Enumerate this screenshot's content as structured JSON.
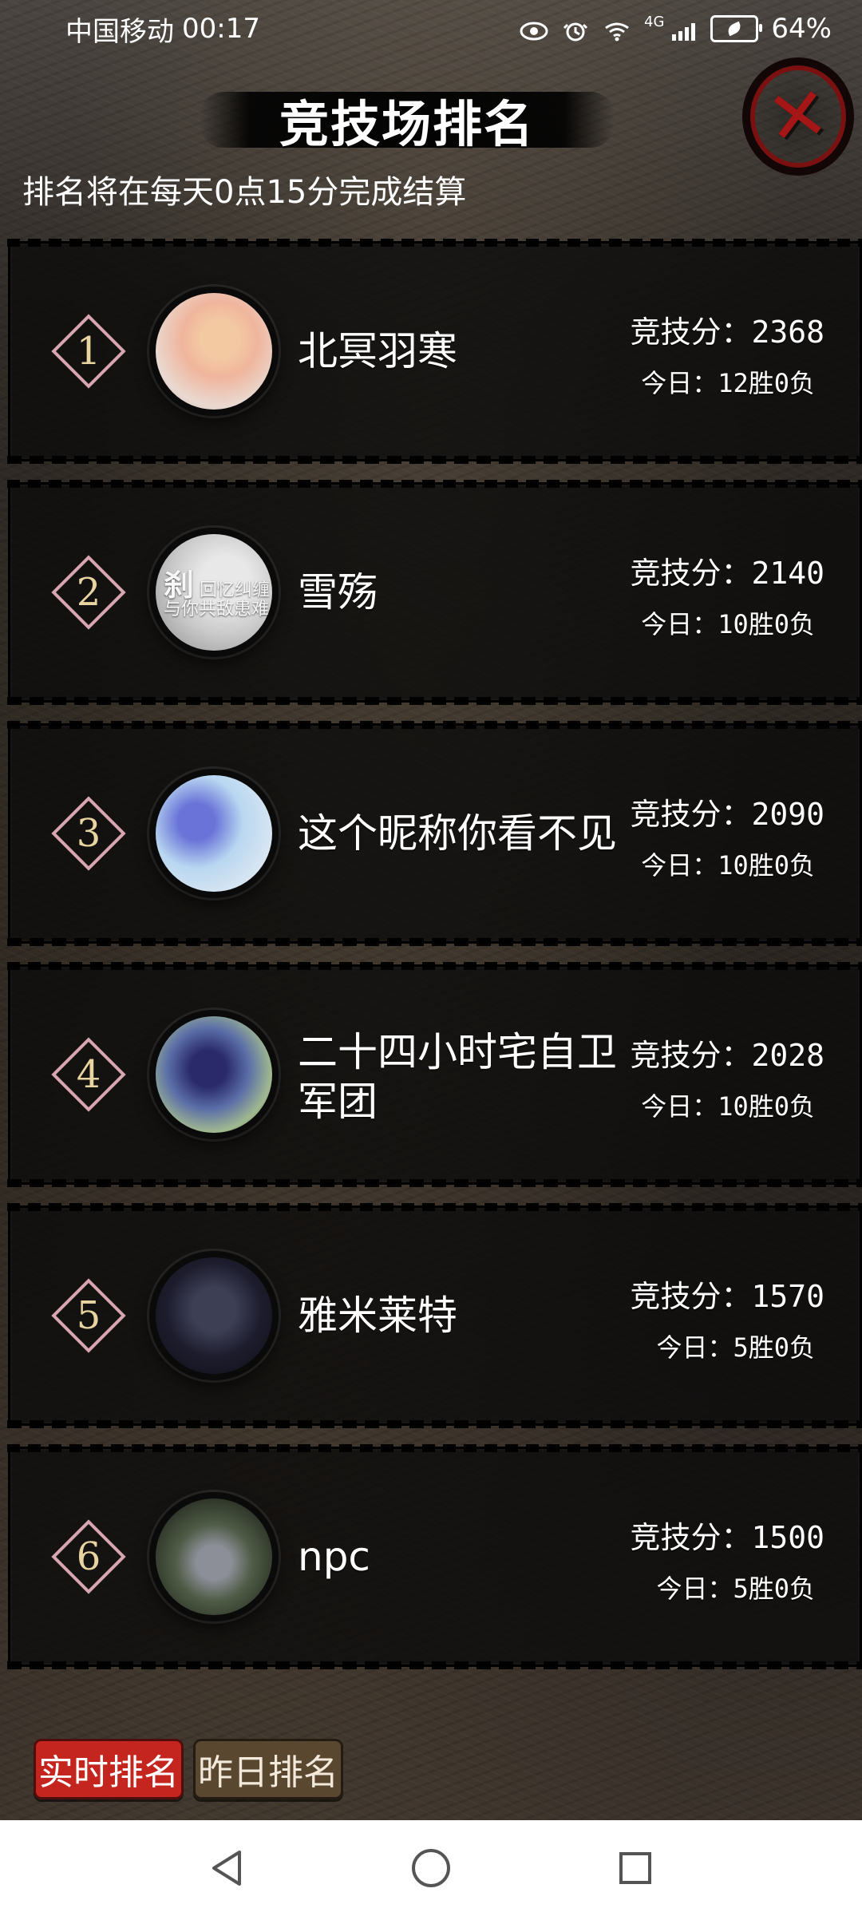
{
  "status_bar": {
    "carrier": "中国移动",
    "time": "00:17",
    "network": "4G",
    "battery_percent": "64%",
    "icons": [
      "eye-icon",
      "alarm-icon",
      "wifi-icon",
      "signal-icon",
      "battery-saver-icon"
    ]
  },
  "header": {
    "title": "竞技场排名",
    "close_icon": "close-x-icon"
  },
  "notice": "排名将在每天0点15分完成结算",
  "rankings": [
    {
      "rank": "1",
      "name": "北冥羽寒",
      "score_label": "竞技分：2368",
      "today_label": "今日：12胜0负",
      "avatar": "avatar-1",
      "avatar_text": ""
    },
    {
      "rank": "2",
      "name": "雪殇",
      "score_label": "竞技分：2140",
      "today_label": "今日：10胜0负",
      "avatar": "avatar-2",
      "avatar_text": {
        "main": "刹",
        "line1": "回忆纠缠",
        "line2": "与你共敌患难"
      }
    },
    {
      "rank": "3",
      "name": "这个昵称你看不见",
      "score_label": "竞技分：2090",
      "today_label": "今日：10胜0负",
      "avatar": "avatar-3",
      "avatar_text": ""
    },
    {
      "rank": "4",
      "name": "二十四小时宅自卫军团",
      "score_label": "竞技分：2028",
      "today_label": "今日：10胜0负",
      "avatar": "avatar-4",
      "avatar_text": ""
    },
    {
      "rank": "5",
      "name": "雅米莱特",
      "score_label": "竞技分：1570",
      "today_label": "今日：5胜0负",
      "avatar": "avatar-5",
      "avatar_text": ""
    },
    {
      "rank": "6",
      "name": "npc",
      "score_label": "竞技分：1500",
      "today_label": "今日：5胜0负",
      "avatar": "avatar-6",
      "avatar_text": ""
    }
  ],
  "tabs": [
    {
      "label": "实时排名",
      "active": true
    },
    {
      "label": "昨日排名",
      "active": false
    }
  ],
  "navbar": {
    "icons": [
      "back-triangle-icon",
      "home-circle-icon",
      "recent-square-icon"
    ]
  },
  "colors": {
    "active_tab": "#c4261f",
    "inactive_tab": "#5a4730",
    "close_red": "#a51616",
    "rank_diamond": "#d8a6b0",
    "rank_number": "#e8d4a0"
  }
}
